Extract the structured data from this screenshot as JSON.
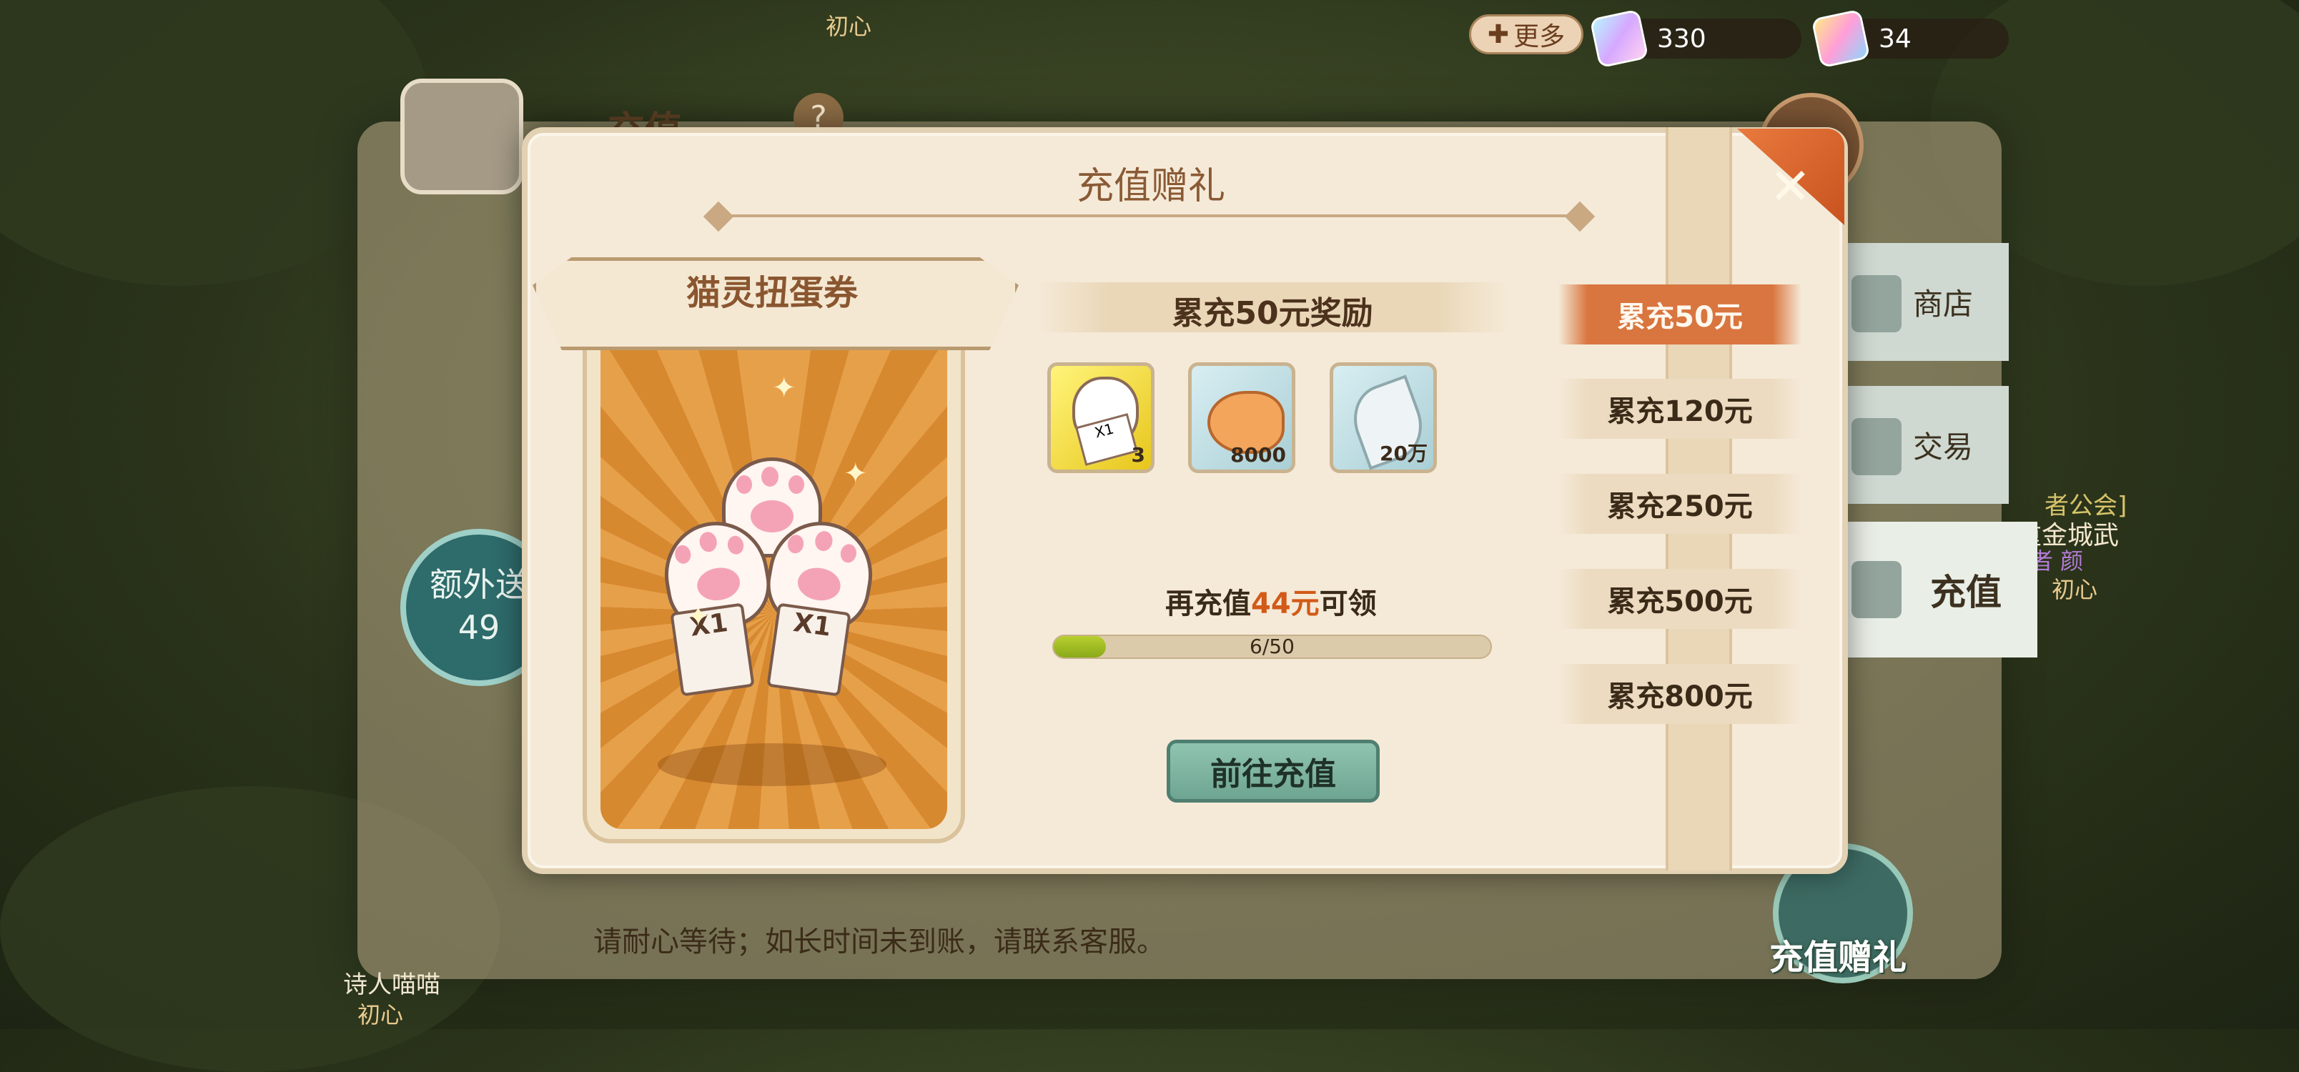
{
  "background": {
    "window_title": "充值",
    "help_label": "?",
    "extra_badge": "额外送",
    "extra_value": "49",
    "hint": "请耐心等待；如长时间未到账，请联系客服。",
    "top_player_tag": "初心",
    "bottom_player_name": "诗人喵喵",
    "bottom_player_tag": "初心",
    "right_guild": "者公会]",
    "right_player_name": "重金城武",
    "right_player_title": "者 颜",
    "right_player_tag": "初心"
  },
  "topbar": {
    "more_label": "更多",
    "more_icon": "plus-icon",
    "currencies": [
      {
        "icon": "crystal-gem-icon",
        "value": "330"
      },
      {
        "icon": "rainbow-gem-icon",
        "value": "34"
      }
    ]
  },
  "side_menu": [
    {
      "label": "商店",
      "icon": "shop-icon"
    },
    {
      "label": "交易",
      "icon": "trade-icon"
    },
    {
      "label": "充值",
      "icon": "recharge-icon",
      "active": true
    }
  ],
  "gift_button": {
    "label": "充值赠礼",
    "icon": "gift-icon"
  },
  "modal": {
    "title": "充值赠礼",
    "close_icon": "close-icon",
    "prize": {
      "name": "猫灵扭蛋券",
      "ticket_text": "X1"
    },
    "tier_header": "累充50元奖励",
    "rewards": [
      {
        "name": "cat-paw-ticket",
        "count": "3",
        "color": "#f0d83a"
      },
      {
        "name": "taiyaki-fish",
        "count": "8000",
        "color": "#bfe0e6"
      },
      {
        "name": "silver-leaf",
        "count": "20万",
        "color": "#bfe0e6"
      }
    ],
    "need_prefix": "再充值",
    "need_amount": "44元",
    "need_suffix": "可领",
    "progress": {
      "current": 6,
      "total": 50,
      "text": "6/50"
    },
    "go_button": "前往充值",
    "tiers": [
      {
        "label": "累充50元",
        "active": true
      },
      {
        "label": "累充120元",
        "active": false
      },
      {
        "label": "累充250元",
        "active": false
      },
      {
        "label": "累充500元",
        "active": false
      },
      {
        "label": "累充800元",
        "active": false
      }
    ]
  },
  "colors": {
    "accent_orange": "#d9753e",
    "progress_green": "#a6c125",
    "button_teal": "#7fb4a2",
    "amount_highlight": "#d25a18"
  }
}
